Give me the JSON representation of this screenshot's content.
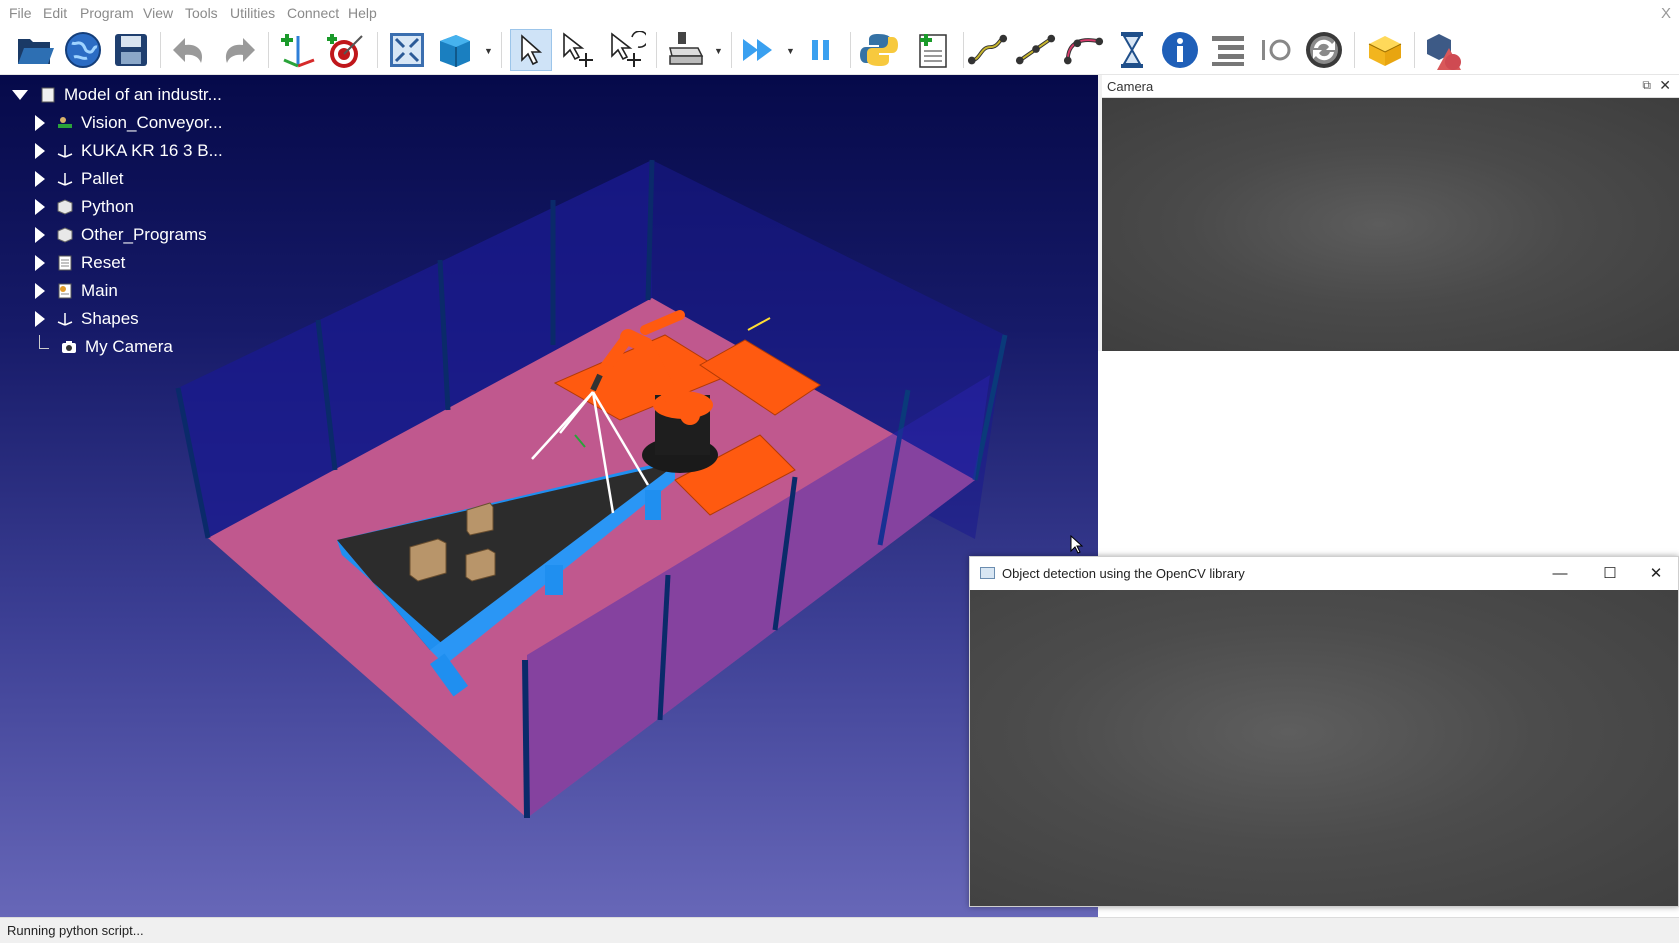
{
  "menu": [
    "File",
    "Edit",
    "Program",
    "View",
    "Tools",
    "Utilities",
    "Connect",
    "Help"
  ],
  "app_close": "X",
  "toolbar": {
    "icons": [
      "open-icon",
      "globe-icon",
      "save-icon",
      "undo-icon",
      "redo-icon",
      "add-frame-icon",
      "add-target-icon",
      "fit-all-icon",
      "view-cube-icon",
      "select-icon",
      "select-move-icon",
      "select-rotate-icon",
      "tool-icon",
      "run-icon",
      "pause-icon",
      "python-icon",
      "add-program-icon",
      "move-joint-icon",
      "move-linear-icon",
      "move-circular-icon",
      "pause-timer-icon",
      "info-icon",
      "program-list-icon",
      "io-icon",
      "sync-icon",
      "package-icon",
      "shapes-icon"
    ]
  },
  "tree": {
    "root": "Model of an industr...",
    "items": [
      {
        "label": "Vision_Conveyor...",
        "icon": "conveyor-icon"
      },
      {
        "label": "KUKA KR 16 3 B...",
        "icon": "robot-frame-icon"
      },
      {
        "label": "Pallet",
        "icon": "frame-icon"
      },
      {
        "label": "Python",
        "icon": "folder-icon"
      },
      {
        "label": "Other_Programs",
        "icon": "folder-icon"
      },
      {
        "label": "Reset",
        "icon": "program-icon"
      },
      {
        "label": "Main",
        "icon": "program-icon"
      },
      {
        "label": "Shapes",
        "icon": "frame-icon"
      },
      {
        "label": "My Camera",
        "icon": "camera-icon"
      }
    ]
  },
  "camera_panel": {
    "title": "Camera",
    "float": "⧉",
    "close": "✕"
  },
  "opencv_window": {
    "title": "Object detection using the OpenCV library",
    "minimize": "—",
    "maximize": "☐",
    "close": "✕"
  },
  "status": "Running python script...",
  "colors": {
    "viewport_top": "#060a4a",
    "viewport_bottom": "#6767b8",
    "floor": "#c0588e",
    "robot": "#ff5a10",
    "conveyor_frame": "#1f8ff0",
    "belt": "#2e2e2e",
    "box": "#b8956a",
    "camera_view": "#4a4a4a"
  }
}
